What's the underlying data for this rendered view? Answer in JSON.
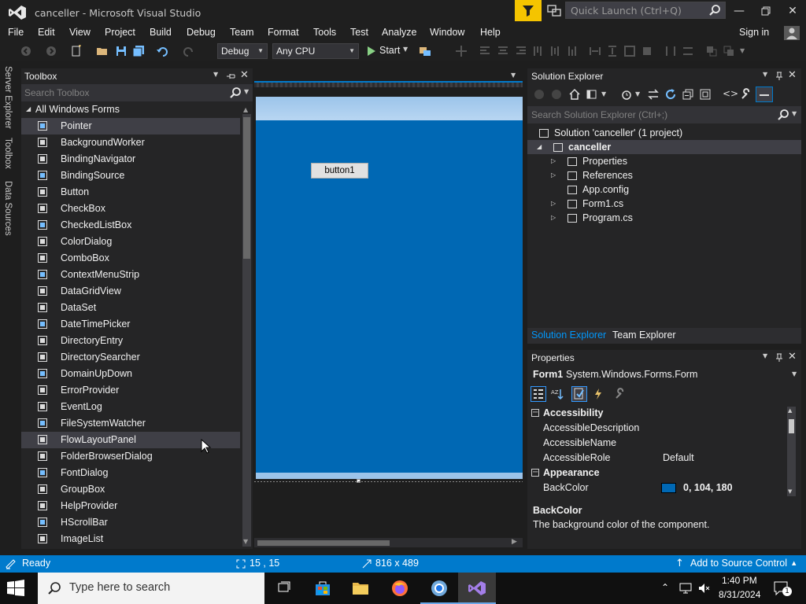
{
  "window": {
    "title": "canceller - Microsoft Visual Studio",
    "quick_launch_placeholder": "Quick Launch (Ctrl+Q)",
    "controls": [
      "minimize-icon",
      "restore-icon",
      "close-icon"
    ]
  },
  "menu": {
    "items": [
      "File",
      "Edit",
      "View",
      "Project",
      "Build",
      "Debug",
      "Team",
      "Format",
      "Tools",
      "Test",
      "Analyze",
      "Window",
      "Help"
    ],
    "sign_in": "Sign in"
  },
  "toolbar": {
    "configuration": "Debug",
    "platform": "Any CPU",
    "start_label": "Start"
  },
  "side_tabs": [
    "Server Explorer",
    "Toolbox",
    "Data Sources"
  ],
  "toolbox": {
    "title": "Toolbox",
    "search_placeholder": "Search Toolbox",
    "group": "All Windows Forms",
    "items": [
      {
        "label": "Pointer",
        "icon": "pointer-icon"
      },
      {
        "label": "BackgroundWorker",
        "icon": "background-worker-icon"
      },
      {
        "label": "BindingNavigator",
        "icon": "binding-navigator-icon"
      },
      {
        "label": "BindingSource",
        "icon": "binding-source-icon"
      },
      {
        "label": "Button",
        "icon": "button-icon"
      },
      {
        "label": "CheckBox",
        "icon": "checkbox-icon"
      },
      {
        "label": "CheckedListBox",
        "icon": "checked-listbox-icon"
      },
      {
        "label": "ColorDialog",
        "icon": "color-dialog-icon"
      },
      {
        "label": "ComboBox",
        "icon": "combobox-icon"
      },
      {
        "label": "ContextMenuStrip",
        "icon": "context-menu-icon"
      },
      {
        "label": "DataGridView",
        "icon": "datagrid-icon"
      },
      {
        "label": "DataSet",
        "icon": "dataset-icon"
      },
      {
        "label": "DateTimePicker",
        "icon": "datetime-icon"
      },
      {
        "label": "DirectoryEntry",
        "icon": "directory-entry-icon"
      },
      {
        "label": "DirectorySearcher",
        "icon": "directory-searcher-icon"
      },
      {
        "label": "DomainUpDown",
        "icon": "domain-updown-icon"
      },
      {
        "label": "ErrorProvider",
        "icon": "error-provider-icon"
      },
      {
        "label": "EventLog",
        "icon": "event-log-icon"
      },
      {
        "label": "FileSystemWatcher",
        "icon": "filesystem-watcher-icon"
      },
      {
        "label": "FlowLayoutPanel",
        "icon": "flow-layout-icon"
      },
      {
        "label": "FolderBrowserDialog",
        "icon": "folder-browser-icon"
      },
      {
        "label": "FontDialog",
        "icon": "font-dialog-icon"
      },
      {
        "label": "GroupBox",
        "icon": "groupbox-icon"
      },
      {
        "label": "HelpProvider",
        "icon": "help-provider-icon"
      },
      {
        "label": "HScrollBar",
        "icon": "hscrollbar-icon"
      },
      {
        "label": "ImageList",
        "icon": "imagelist-icon"
      }
    ]
  },
  "designer": {
    "button_label": "button1"
  },
  "solution_explorer": {
    "title": "Solution Explorer",
    "search_placeholder": "Search Solution Explorer (Ctrl+;)",
    "tree": [
      {
        "label": "Solution 'canceller' (1 project)",
        "level": 0,
        "expander": ""
      },
      {
        "label": "canceller",
        "level": 1,
        "expander": "open",
        "bold": true
      },
      {
        "label": "Properties",
        "level": 2,
        "expander": "closed"
      },
      {
        "label": "References",
        "level": 2,
        "expander": "closed"
      },
      {
        "label": "App.config",
        "level": 2,
        "expander": ""
      },
      {
        "label": "Form1.cs",
        "level": 2,
        "expander": "closed"
      },
      {
        "label": "Program.cs",
        "level": 2,
        "expander": "closed"
      }
    ],
    "tabs": [
      "Solution Explorer",
      "Team Explorer"
    ]
  },
  "properties": {
    "title": "Properties",
    "object_name": "Form1",
    "object_type": "System.Windows.Forms.Form",
    "rows": [
      {
        "name": "Accessibility",
        "value": "",
        "category": true
      },
      {
        "name": "AccessibleDescription",
        "value": ""
      },
      {
        "name": "AccessibleName",
        "value": ""
      },
      {
        "name": "AccessibleRole",
        "value": "Default"
      },
      {
        "name": "Appearance",
        "value": "",
        "category": true
      },
      {
        "name": "BackColor",
        "value": "0, 104, 180",
        "swatch": "#0068b4"
      }
    ],
    "description_title": "BackColor",
    "description_text": "The background color of the component."
  },
  "status": {
    "text": "Ready",
    "position": "15 , 15",
    "size": "816 x 489",
    "source_control": "Add to Source Control"
  },
  "taskbar": {
    "search_placeholder": "Type here to search",
    "apps": [
      "task-view-icon",
      "store-icon",
      "file-explorer-icon",
      "firefox-icon",
      "chrome-icon",
      "visual-studio-icon"
    ],
    "time": "1:40 PM",
    "date": "8/31/2024",
    "notification_count": "1"
  },
  "colors": {
    "accent": "#007acc",
    "form_backcolor": "#0068b4",
    "filter_yellow": "#f5c400"
  }
}
